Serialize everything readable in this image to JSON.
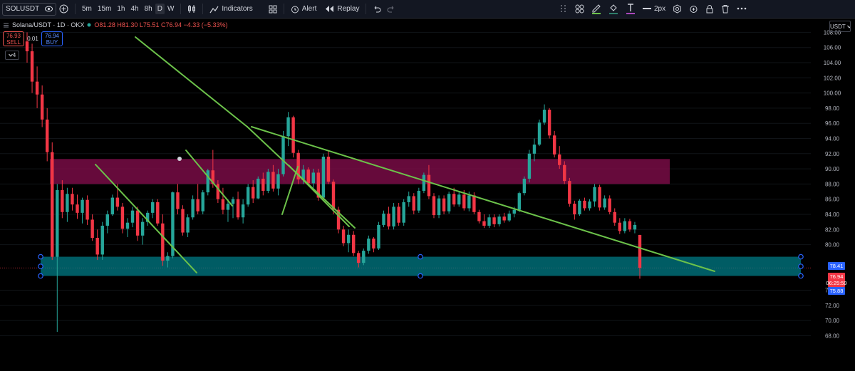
{
  "toolbar": {
    "symbol": "SOLUSDT",
    "timeframes": [
      "5m",
      "15m",
      "1h",
      "4h",
      "8h",
      "D",
      "W"
    ],
    "active_timeframe": "D",
    "indicators_label": "Indicators",
    "alert_label": "Alert",
    "replay_label": "Replay",
    "line_width_label": "2px"
  },
  "legend": {
    "title": "Solana/USDT · 1D · OKX",
    "ohlc": "O81.28 H81.30 L75.51 C76.94 −4.33 (−5.33%)"
  },
  "trade": {
    "sell_price": "76.93",
    "sell_label": "SELL",
    "quantity": "0.01",
    "buy_price": "76.94",
    "buy_label": "BUY"
  },
  "collapse_count": "4",
  "currency": "USDT",
  "price_axis": {
    "ticks": [
      "108.00",
      "106.00",
      "104.00",
      "102.00",
      "100.00",
      "98.00",
      "96.00",
      "94.00",
      "92.00",
      "90.00",
      "88.00",
      "86.00",
      "84.00",
      "82.00",
      "80.00",
      "74.00",
      "72.00",
      "70.00",
      "68.00"
    ],
    "upper_label": "78.41",
    "current_price": "76.94",
    "countdown": "06:25:59",
    "lower_label": "75.88"
  },
  "colors": {
    "up": "#26a69a",
    "down": "#f23645",
    "trendline": "#6cc24a",
    "resistance_zone": "#880e4f",
    "support_zone": "#00838f",
    "background": "#000000"
  },
  "chart_data": {
    "type": "candlestick",
    "timeframe": "1D",
    "price_range": [
      66,
      110
    ],
    "candles_ohlc": [
      [
        106.8,
        108.0,
        104.0,
        105.5
      ],
      [
        105.5,
        106.5,
        100.0,
        101.5
      ],
      [
        101.5,
        103.5,
        98.0,
        99.8
      ],
      [
        99.8,
        101.0,
        95.5,
        96.5
      ],
      [
        96.5,
        98.0,
        91.0,
        92.2
      ],
      [
        92.2,
        93.5,
        78.0,
        78.4
      ],
      [
        78.4,
        88.0,
        72.0,
        87.2
      ],
      [
        87.2,
        88.5,
        83.5,
        84.3
      ],
      [
        84.3,
        87.5,
        83.0,
        86.7
      ],
      [
        86.7,
        87.5,
        84.5,
        85.3
      ],
      [
        85.3,
        86.6,
        83.4,
        84.2
      ],
      [
        84.2,
        86.2,
        82.8,
        85.9
      ],
      [
        85.9,
        86.5,
        82.6,
        83.3
      ],
      [
        83.3,
        84.0,
        80.5,
        80.9
      ],
      [
        80.9,
        82.0,
        78.0,
        78.7
      ],
      [
        78.7,
        83.0,
        78.0,
        82.5
      ],
      [
        82.5,
        84.5,
        81.5,
        84.0
      ],
      [
        84.0,
        86.6,
        83.8,
        86.2
      ],
      [
        86.2,
        88.0,
        84.5,
        85.0
      ],
      [
        85.0,
        85.5,
        81.5,
        82.1
      ],
      [
        82.1,
        83.5,
        81.0,
        82.9
      ],
      [
        82.9,
        85.0,
        82.3,
        84.5
      ],
      [
        84.5,
        85.0,
        80.5,
        81.2
      ],
      [
        81.2,
        83.5,
        80.0,
        83.0
      ],
      [
        83.0,
        84.5,
        82.5,
        84.2
      ],
      [
        84.2,
        86.0,
        83.5,
        85.6
      ],
      [
        85.6,
        86.0,
        82.5,
        82.8
      ],
      [
        82.8,
        84.0,
        77.2,
        77.9
      ],
      [
        77.9,
        79.0,
        77.0,
        78.5
      ],
      [
        78.5,
        87.0,
        78.2,
        86.9
      ],
      [
        86.9,
        88.0,
        84.0,
        84.7
      ],
      [
        84.7,
        85.2,
        81.2,
        81.6
      ],
      [
        81.6,
        84.0,
        81.0,
        83.6
      ],
      [
        83.6,
        86.5,
        83.3,
        86.0
      ],
      [
        86.0,
        88.0,
        84.0,
        84.4
      ],
      [
        84.4,
        87.2,
        84.0,
        86.9
      ],
      [
        86.9,
        90.0,
        86.5,
        89.8
      ],
      [
        89.8,
        92.5,
        87.5,
        88.0
      ],
      [
        88.0,
        88.5,
        85.5,
        86.0
      ],
      [
        86.0,
        87.5,
        84.0,
        84.6
      ],
      [
        84.6,
        86.0,
        83.0,
        85.4
      ],
      [
        85.4,
        86.3,
        83.5,
        86.0
      ],
      [
        86.0,
        87.0,
        83.3,
        83.6
      ],
      [
        83.6,
        86.0,
        82.8,
        85.3
      ],
      [
        85.3,
        88.0,
        85.0,
        87.6
      ],
      [
        87.6,
        88.5,
        85.5,
        86.1
      ],
      [
        86.1,
        89.0,
        86.0,
        88.7
      ],
      [
        88.7,
        89.5,
        86.5,
        87.1
      ],
      [
        87.1,
        90.0,
        86.8,
        89.6
      ],
      [
        89.6,
        90.5,
        87.0,
        87.4
      ],
      [
        87.4,
        90.0,
        86.5,
        89.3
      ],
      [
        89.3,
        95.0,
        89.0,
        94.3
      ],
      [
        94.3,
        97.5,
        93.0,
        96.8
      ],
      [
        96.8,
        97.0,
        91.5,
        92.1
      ],
      [
        92.1,
        92.5,
        88.0,
        88.6
      ],
      [
        88.6,
        90.5,
        88.0,
        89.9
      ],
      [
        89.9,
        90.2,
        87.8,
        88.1
      ],
      [
        88.1,
        90.0,
        87.5,
        89.5
      ],
      [
        89.5,
        90.0,
        85.8,
        86.2
      ],
      [
        86.2,
        92.0,
        86.0,
        91.6
      ],
      [
        91.6,
        92.4,
        88.0,
        88.3
      ],
      [
        88.3,
        88.6,
        84.0,
        84.6
      ],
      [
        84.6,
        85.0,
        81.5,
        82.0
      ],
      [
        82.0,
        82.5,
        79.8,
        80.2
      ],
      [
        80.2,
        82.0,
        79.0,
        81.3
      ],
      [
        81.3,
        81.8,
        78.5,
        78.9
      ],
      [
        78.9,
        79.2,
        77.0,
        77.6
      ],
      [
        77.6,
        79.5,
        77.3,
        79.2
      ],
      [
        79.2,
        81.2,
        78.8,
        80.8
      ],
      [
        80.8,
        81.0,
        79.0,
        79.5
      ],
      [
        79.5,
        83.0,
        79.3,
        82.6
      ],
      [
        82.6,
        84.5,
        82.3,
        84.1
      ],
      [
        84.1,
        85.0,
        82.0,
        82.4
      ],
      [
        82.4,
        85.5,
        82.0,
        85.0
      ],
      [
        85.0,
        85.5,
        82.5,
        82.9
      ],
      [
        82.9,
        86.0,
        82.5,
        85.6
      ],
      [
        85.6,
        87.0,
        85.0,
        86.4
      ],
      [
        86.4,
        86.8,
        84.0,
        84.5
      ],
      [
        84.5,
        87.5,
        84.2,
        87.1
      ],
      [
        87.1,
        89.5,
        86.8,
        89.2
      ],
      [
        89.2,
        90.5,
        86.0,
        86.4
      ],
      [
        86.4,
        86.8,
        83.5,
        83.9
      ],
      [
        83.9,
        86.5,
        83.5,
        86.1
      ],
      [
        86.1,
        86.5,
        84.0,
        84.4
      ],
      [
        84.4,
        87.0,
        84.1,
        86.7
      ],
      [
        86.7,
        87.5,
        85.0,
        85.3
      ],
      [
        85.3,
        87.0,
        85.0,
        86.6
      ],
      [
        86.6,
        87.2,
        84.5,
        84.8
      ],
      [
        84.8,
        87.0,
        84.4,
        86.5
      ],
      [
        86.5,
        86.9,
        84.0,
        84.3
      ],
      [
        84.3,
        84.6,
        82.8,
        83.1
      ],
      [
        83.1,
        84.0,
        82.2,
        82.5
      ],
      [
        82.5,
        84.0,
        82.2,
        83.6
      ],
      [
        83.6,
        84.0,
        82.3,
        82.7
      ],
      [
        82.7,
        84.0,
        82.4,
        83.7
      ],
      [
        83.7,
        84.2,
        82.9,
        83.2
      ],
      [
        83.2,
        84.5,
        83.0,
        84.1
      ],
      [
        84.1,
        85.0,
        83.6,
        84.6
      ],
      [
        84.6,
        87.0,
        84.3,
        86.8
      ],
      [
        86.8,
        89.0,
        86.5,
        88.7
      ],
      [
        88.7,
        92.5,
        88.2,
        92.0
      ],
      [
        92.0,
        94.0,
        91.0,
        93.2
      ],
      [
        93.2,
        96.5,
        93.0,
        96.1
      ],
      [
        96.1,
        98.5,
        95.8,
        97.8
      ],
      [
        97.8,
        98.0,
        94.0,
        94.4
      ],
      [
        94.4,
        95.0,
        91.5,
        91.9
      ],
      [
        91.9,
        93.0,
        90.0,
        90.5
      ],
      [
        90.5,
        91.0,
        88.0,
        88.4
      ],
      [
        88.4,
        88.8,
        85.0,
        85.4
      ],
      [
        85.4,
        85.8,
        83.3,
        84.0
      ],
      [
        84.0,
        86.0,
        83.8,
        85.8
      ],
      [
        85.8,
        86.2,
        84.5,
        84.8
      ],
      [
        84.8,
        86.0,
        84.5,
        85.7
      ],
      [
        85.7,
        88.0,
        85.0,
        87.6
      ],
      [
        87.6,
        87.9,
        84.5,
        84.9
      ],
      [
        84.9,
        86.5,
        84.6,
        86.1
      ],
      [
        86.1,
        86.5,
        84.0,
        84.3
      ],
      [
        84.3,
        84.8,
        82.5,
        82.9
      ],
      [
        82.9,
        83.5,
        81.4,
        81.8
      ],
      [
        81.8,
        83.5,
        81.5,
        83.1
      ],
      [
        83.1,
        83.4,
        81.7,
        82.0
      ],
      [
        82.0,
        83.0,
        81.5,
        82.6
      ],
      [
        81.28,
        81.3,
        75.51,
        76.94
      ]
    ],
    "resistance_zone": [
      88.0,
      91.3
    ],
    "support_zone": [
      75.88,
      78.41
    ],
    "trendline_count": 7
  }
}
